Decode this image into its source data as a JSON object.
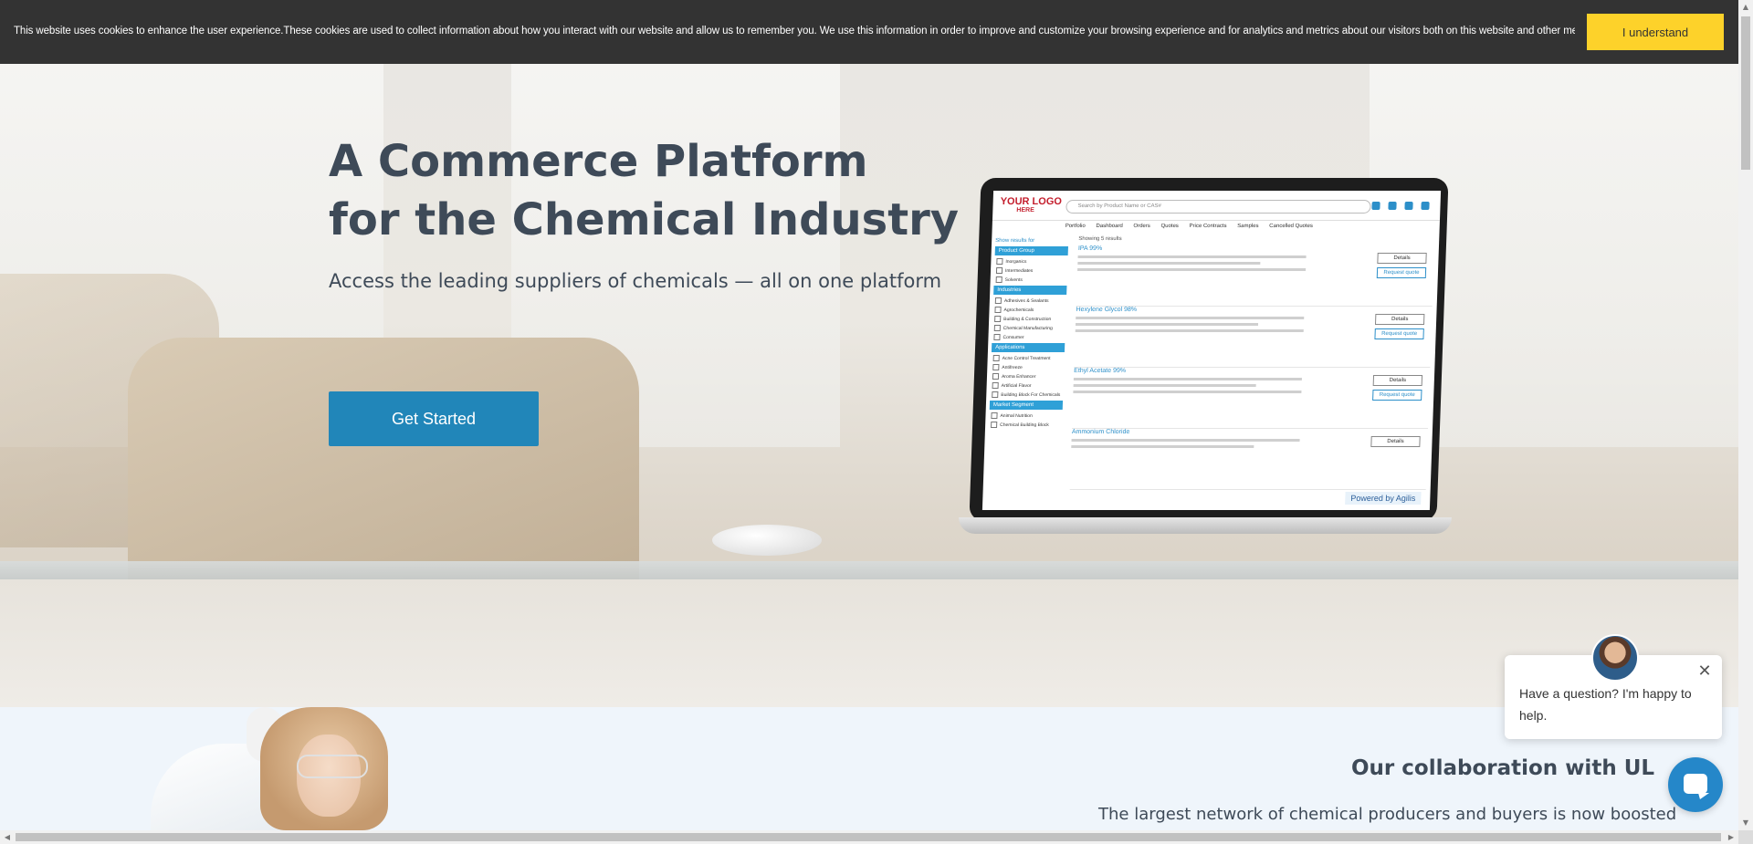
{
  "cookie_banner": {
    "message": "This website uses cookies to enhance the user experience.These cookies are used to collect information about how you interact with our website and allow us to remember you. We use this information in order to improve and customize your browsing experience and for analytics and metrics about our visitors both on this website and other media.",
    "accept_label": "I understand",
    "accept_color": "#fdd22a"
  },
  "hero": {
    "title_line1": "A Commerce Platform",
    "title_line2": "for the Chemical Industry",
    "subtitle": "Access the leading suppliers of chemicals — all on one platform",
    "cta_label": "Get Started",
    "cta_color": "#2186b9",
    "laptop_screen": {
      "logo_line1": "YOUR LOGO",
      "logo_line2": "HERE",
      "search_placeholder": "Search by Product Name or CAS#",
      "nav": [
        "Portfolio",
        "Dashboard",
        "Orders",
        "Quotes",
        "Price Contracts",
        "Samples",
        "Cancelled Quotes"
      ],
      "filter_title": "Show results for",
      "filter_groups": [
        {
          "header": "Product Group",
          "items": [
            "Inorganics",
            "Intermediates",
            "Solvents"
          ]
        },
        {
          "header": "Industries",
          "items": [
            "Adhesives & Sealants",
            "Agrochemicals",
            "Building & Construction",
            "Chemical Manufacturing",
            "Consumer"
          ]
        },
        {
          "header": "Applications",
          "items": [
            "Acne Control Treatment",
            "Antifreeze",
            "Aroma Enhancer",
            "Artificial Flavor",
            "Building Block For Chemicals"
          ]
        },
        {
          "header": "Market Segment",
          "items": [
            "Animal Nutrition",
            "Chemical Building Block"
          ]
        }
      ],
      "showing": "Showing 5 results",
      "products": [
        {
          "name": "IPA 99%",
          "details": "Details",
          "quote": "Request quote"
        },
        {
          "name": "Hexylene Glycol 98%",
          "details": "Details",
          "quote": "Request quote"
        },
        {
          "name": "Ethyl Acetate 99%",
          "details": "Details",
          "quote": "Request quote"
        },
        {
          "name": "Ammonium Chloride",
          "details": "Details",
          "quote": ""
        }
      ],
      "powered_by": "Powered by Agilis"
    }
  },
  "collaboration": {
    "title": "Our collaboration with UL",
    "text": "The largest network of chemical producers and buyers is now boosted"
  },
  "chat_widget": {
    "message": "Have a question? I'm happy to help.",
    "close_symbol": "✕",
    "launcher_color": "#2587c9"
  },
  "icons": {
    "close": "close-icon",
    "chat": "chat-icon",
    "avatar": "agent-avatar"
  }
}
